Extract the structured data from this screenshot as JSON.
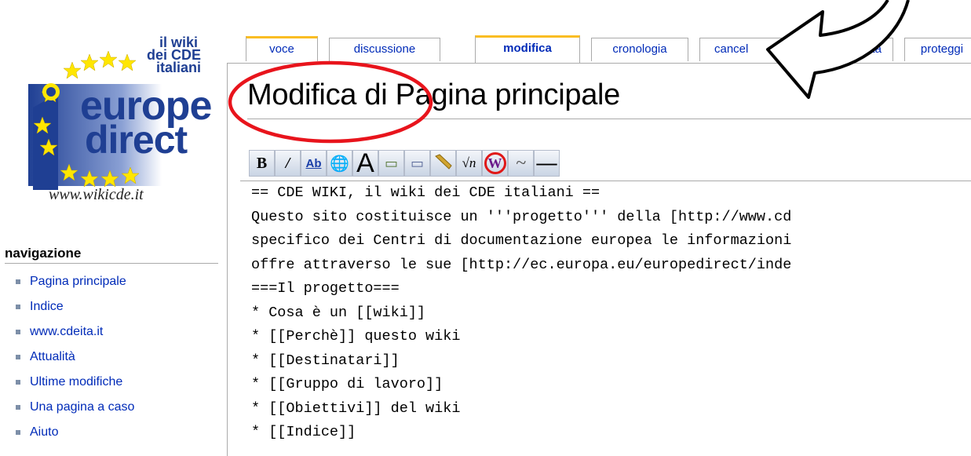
{
  "logo": {
    "line1": "il wiki",
    "line2": "dei CDE",
    "line3": "italiani",
    "europe": "europe",
    "direct": "direct",
    "url": "www.wikicde.it",
    "icon": "europe-direct-logo"
  },
  "sidebar": {
    "heading": "navigazione",
    "items": [
      {
        "label": "Pagina principale"
      },
      {
        "label": "Indice"
      },
      {
        "label": "www.cdeita.it"
      },
      {
        "label": "Attualità"
      },
      {
        "label": "Ultime modifiche"
      },
      {
        "label": "Una pagina a caso"
      },
      {
        "label": "Aiuto"
      }
    ]
  },
  "tabs": [
    {
      "label": "voce"
    },
    {
      "label": "discussione"
    },
    {
      "label": "modifica"
    },
    {
      "label": "cronologia"
    },
    {
      "label": "cancel"
    },
    {
      "label": "ta"
    },
    {
      "label": "proteggi"
    }
  ],
  "page": {
    "title": "Modifica di Pagina principale"
  },
  "toolbar": {
    "buttons": [
      {
        "icon": "bold-icon",
        "glyph": "B"
      },
      {
        "icon": "italic-icon",
        "glyph": "/"
      },
      {
        "icon": "internal-link-icon",
        "glyph": "Ab"
      },
      {
        "icon": "external-link-icon",
        "glyph": "🌐"
      },
      {
        "icon": "headline-icon",
        "glyph": "A"
      },
      {
        "icon": "image-icon",
        "glyph": "▭"
      },
      {
        "icon": "media-icon",
        "glyph": "▭"
      },
      {
        "icon": "math-icon",
        "glyph": "√n"
      },
      {
        "icon": "nowiki-icon",
        "glyph": "W"
      },
      {
        "icon": "signature-icon",
        "glyph": "~"
      },
      {
        "icon": "horizontal-line-icon",
        "glyph": "—"
      }
    ]
  },
  "editor": {
    "lines": [
      "== CDE WIKI, il wiki dei CDE italiani ==",
      "Questo sito costituisce un '''progetto''' della [http://www.cd",
      "specifico dei Centri di documentazione europea le informazioni",
      "offre attraverso le sue [http://ec.europa.eu/europedirect/inde",
      "===Il progetto===",
      "* Cosa è un [[wiki]]",
      "* [[Perchè]] questo wiki",
      "* [[Destinatari]]",
      "* [[Gruppo di lavoro]]",
      "* [[Obiettivi]] del wiki",
      "* [[Indice]]"
    ]
  },
  "colors": {
    "link": "#002bb8",
    "tab_accent": "#fabd23",
    "border": "#aaaaaa",
    "annotation": "#e8141c",
    "logo_blue": "#1f3f93",
    "star_yellow": "#ffe600"
  }
}
